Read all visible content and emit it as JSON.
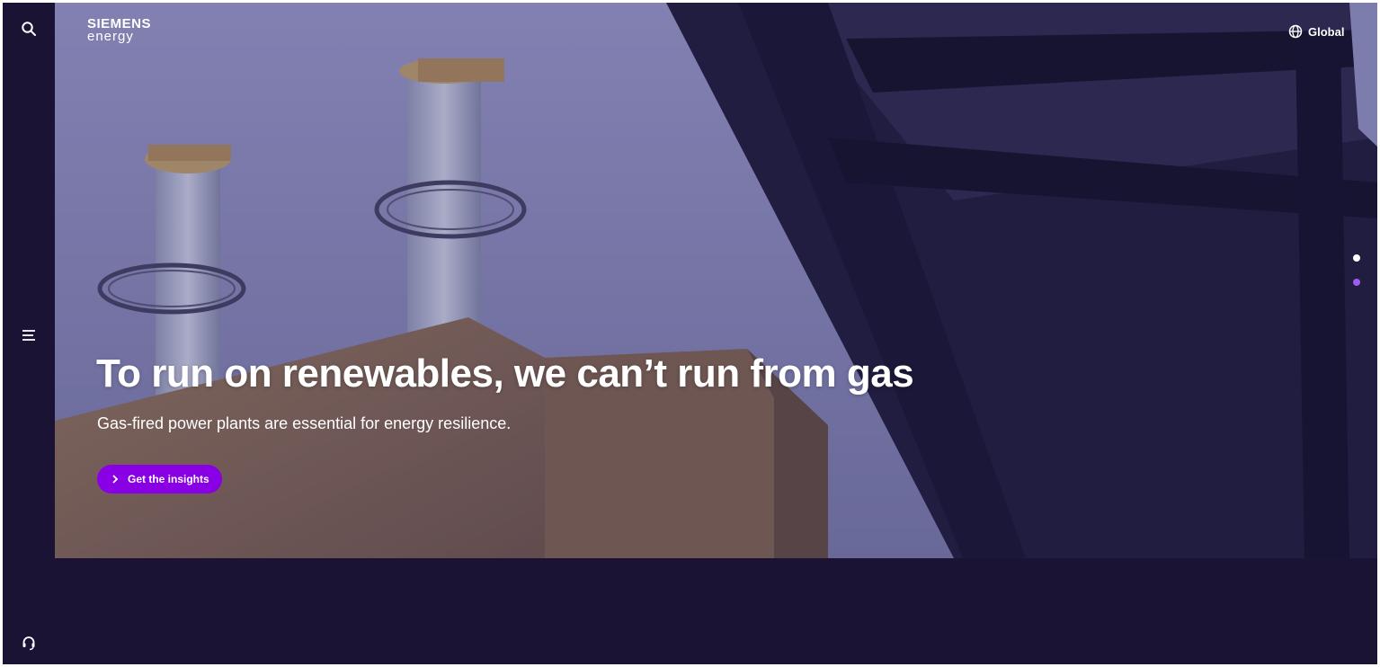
{
  "header": {
    "logo_line1": "SIEMENS",
    "logo_line2": "energy",
    "region_label": "Global"
  },
  "rail": {
    "icons": [
      "search-icon",
      "menu-icon",
      "headset-icon"
    ]
  },
  "hero": {
    "headline": "To run on renewables, we can’t run from gas",
    "subline": "Gas-fired power plants are essential for energy resilience.",
    "cta_label": "Get the insights"
  },
  "carousel": {
    "slide_count": 2,
    "active_index": 0,
    "colors": {
      "active": "#ffffff",
      "inactive": "#9b5cf0"
    }
  },
  "colors": {
    "background": "#1a1333",
    "accent": "#8a00e5",
    "text": "#ffffff"
  }
}
